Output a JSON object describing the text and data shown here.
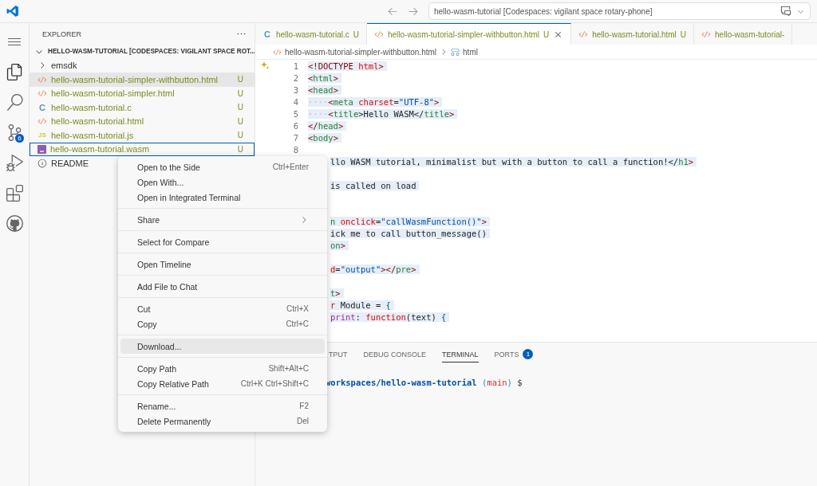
{
  "title_bar": {
    "command_center": "hello-wasm-tutorial [Codespaces: vigilant space rotary-phone]"
  },
  "activity_bar": {
    "items": [
      {
        "kind": "files",
        "selected": true
      },
      {
        "kind": "search",
        "selected": false
      },
      {
        "kind": "source-control",
        "selected": false,
        "badge": "6"
      },
      {
        "kind": "run",
        "selected": false
      },
      {
        "kind": "extensions",
        "selected": false
      },
      {
        "kind": "github",
        "selected": false
      }
    ]
  },
  "sidebar": {
    "title": "EXPLORER",
    "root": {
      "label": "HELLO-WASM-TUTORIAL [CODESPACES: VIGILANT SPACE ROT...",
      "expanded": true,
      "children": [
        {
          "label": "emsdk",
          "kind": "folder",
          "expanded": false,
          "selected": false,
          "focused": false
        },
        {
          "label": "hello-wasm-tutorial-simpler-withbutton.html",
          "kind": "html",
          "status": "U",
          "selected": true,
          "focused": false
        },
        {
          "label": "hello-wasm-tutorial-simpler.html",
          "kind": "html",
          "status": "U",
          "selected": false,
          "focused": false
        },
        {
          "label": "hello-wasm-tutorial.c",
          "kind": "c",
          "icon_label": "C",
          "status": "U",
          "selected": false,
          "focused": false
        },
        {
          "label": "hello-wasm-tutorial.html",
          "kind": "html",
          "status": "U",
          "selected": false,
          "focused": false
        },
        {
          "label": "hello-wasm-tutorial.js",
          "kind": "js",
          "icon_label": "JS",
          "status": "U",
          "selected": false,
          "focused": false
        },
        {
          "label": "hello-wasm-tutorial.wasm",
          "kind": "wasm",
          "status": "U",
          "selected": false,
          "focused": true
        },
        {
          "label": "README",
          "kind": "info",
          "selected": false,
          "focused": false
        }
      ]
    }
  },
  "tabs": [
    {
      "label": "hello-wasm-tutorial.c",
      "kind": "c",
      "icon_label": "C",
      "status": "U",
      "selected": false
    },
    {
      "label": "hello-wasm-tutorial-simpler-withbutton.html",
      "kind": "html",
      "status": "U",
      "selected": true
    },
    {
      "label": "hello-wasm-tutorial.html",
      "kind": "html",
      "status": "U",
      "selected": false
    },
    {
      "label": "hello-wasm-tutorial-",
      "kind": "html",
      "selected": false
    }
  ],
  "breadcrumb": [
    "hello-wasm-tutorial-simpler-withbutton.html",
    "html"
  ],
  "code_lines": [
    {
      "kind": "full",
      "number": "1",
      "tokens": [
        {
          "t": "<!DOCTYPE ",
          "kind": "punct"
        },
        {
          "t": "html",
          "kind": "attr"
        },
        {
          "t": ">",
          "kind": "punct"
        }
      ]
    },
    {
      "kind": "full",
      "number": "2",
      "tokens": [
        {
          "t": "<",
          "kind": "punct"
        },
        {
          "t": "html",
          "kind": "tag"
        },
        {
          "t": ">",
          "kind": "punct"
        }
      ]
    },
    {
      "kind": "full",
      "number": "3",
      "tokens": [
        {
          "t": "<",
          "kind": "punct"
        },
        {
          "t": "head",
          "kind": "tag"
        },
        {
          "t": ">",
          "kind": "punct"
        }
      ]
    },
    {
      "kind": "full",
      "number": "4",
      "tokens": [
        {
          "t": "····",
          "kind": "ws"
        },
        {
          "t": "<",
          "kind": "punct"
        },
        {
          "t": "meta",
          "kind": "tag"
        },
        {
          "t": " charset",
          "kind": "attr"
        },
        {
          "t": "=",
          "kind": "text"
        },
        {
          "t": "\"UTF-8\"",
          "kind": "string"
        },
        {
          "t": ">",
          "kind": "punct"
        }
      ]
    },
    {
      "kind": "full",
      "number": "5",
      "tokens": [
        {
          "t": "····",
          "kind": "ws"
        },
        {
          "t": "<",
          "kind": "punct"
        },
        {
          "t": "title",
          "kind": "tag"
        },
        {
          "t": ">Hello WASM</",
          "kind": "text"
        },
        {
          "t": "title",
          "kind": "tag"
        },
        {
          "t": ">",
          "kind": "punct"
        }
      ]
    },
    {
      "kind": "full",
      "number": "6",
      "tokens": [
        {
          "t": "</",
          "kind": "punct"
        },
        {
          "t": "head",
          "kind": "tag"
        },
        {
          "t": ">",
          "kind": "punct"
        }
      ]
    },
    {
      "kind": "full",
      "number": "7",
      "tokens": [
        {
          "t": "<",
          "kind": "punct"
        },
        {
          "t": "body",
          "kind": "tag"
        },
        {
          "t": ">",
          "kind": "punct"
        }
      ]
    },
    {
      "kind": "full",
      "number": "8"
    },
    {
      "kind": "clipped",
      "tokens": [
        {
          "t": "llo WASM tutorial, minimalist but with a button to call a function!</",
          "kind": "text"
        },
        {
          "t": "h1",
          "kind": "tag"
        },
        {
          "t": ">",
          "kind": "punct"
        }
      ]
    },
    {
      "kind": "clipped"
    },
    {
      "kind": "clipped",
      "tokens": [
        {
          "t": "is called on load",
          "kind": "text"
        }
      ]
    },
    {
      "kind": "clipped"
    },
    {
      "kind": "clipped"
    },
    {
      "kind": "clipped",
      "tokens": [
        {
          "t": "n ",
          "kind": "tag"
        },
        {
          "t": "onclick",
          "kind": "attr"
        },
        {
          "t": "=",
          "kind": "text"
        },
        {
          "t": "\"callWasmFunction()\"",
          "kind": "string"
        },
        {
          "t": ">",
          "kind": "punct"
        }
      ]
    },
    {
      "kind": "clipped",
      "tokens": [
        {
          "t": "ick me to call button_message()",
          "kind": "text"
        }
      ]
    },
    {
      "kind": "clipped",
      "tokens": [
        {
          "t": "on",
          "kind": "tag"
        },
        {
          "t": ">",
          "kind": "punct"
        }
      ]
    },
    {
      "kind": "clipped"
    },
    {
      "kind": "clipped",
      "tokens": [
        {
          "t": "d",
          "kind": "attr"
        },
        {
          "t": "=",
          "kind": "text"
        },
        {
          "t": "\"output\"",
          "kind": "string"
        },
        {
          "t": "></",
          "kind": "punct"
        },
        {
          "t": "pre",
          "kind": "tag"
        },
        {
          "t": ">",
          "kind": "punct"
        }
      ]
    },
    {
      "kind": "clipped"
    },
    {
      "kind": "clipped",
      "tokens": [
        {
          "t": "t",
          "kind": "tag"
        },
        {
          "t": ">",
          "kind": "punct"
        }
      ]
    },
    {
      "kind": "clipped",
      "tokens": [
        {
          "t": "r",
          "kind": "attr"
        },
        {
          "t": " Module = ",
          "kind": "text"
        },
        {
          "t": "{",
          "kind": "string"
        }
      ]
    },
    {
      "kind": "clipped",
      "tokens": [
        {
          "t": "print",
          "kind": "fn"
        },
        {
          "t": ": ",
          "kind": "text"
        },
        {
          "t": "function",
          "kind": "attr"
        },
        {
          "t": "(text) ",
          "kind": "text"
        },
        {
          "t": "{",
          "kind": "string"
        }
      ]
    }
  ],
  "panel": {
    "tabs": [
      {
        "label": "TPUT",
        "selected": false
      },
      {
        "label": "DEBUG CONSOLE",
        "selected": false
      },
      {
        "label": "TERMINAL",
        "selected": true
      },
      {
        "label": "PORTS",
        "selected": false,
        "badge": "1"
      }
    ],
    "terminal": {
      "path": "workspaces/hello-wasm-tutorial",
      "branch": "main",
      "open": "(",
      "close": ")",
      "prompt": "$"
    }
  },
  "context_menu": {
    "groups": [
      [
        {
          "label": "Open to the Side",
          "shortcut": "Ctrl+Enter",
          "highlighted": false
        },
        {
          "label": "Open With...",
          "highlighted": false
        },
        {
          "label": "Open in Integrated Terminal",
          "highlighted": false
        }
      ],
      [
        {
          "label": "Share",
          "submenu": true,
          "highlighted": false
        }
      ],
      [
        {
          "label": "Select for Compare",
          "highlighted": false
        }
      ],
      [
        {
          "label": "Open Timeline",
          "highlighted": false
        }
      ],
      [
        {
          "label": "Add File to Chat",
          "highlighted": false
        }
      ],
      [
        {
          "label": "Cut",
          "shortcut": "Ctrl+X",
          "highlighted": false
        },
        {
          "label": "Copy",
          "shortcut": "Ctrl+C",
          "highlighted": false
        }
      ],
      [
        {
          "label": "Download...",
          "highlighted": true
        }
      ],
      [
        {
          "label": "Copy Path",
          "shortcut": "Shift+Alt+C",
          "highlighted": false
        },
        {
          "label": "Copy Relative Path",
          "shortcut": "Ctrl+K Ctrl+Shift+C",
          "highlighted": false
        }
      ],
      [
        {
          "label": "Rename...",
          "shortcut": "F2",
          "highlighted": false
        },
        {
          "label": "Delete Permanently",
          "shortcut": "Del",
          "highlighted": false
        }
      ]
    ]
  }
}
